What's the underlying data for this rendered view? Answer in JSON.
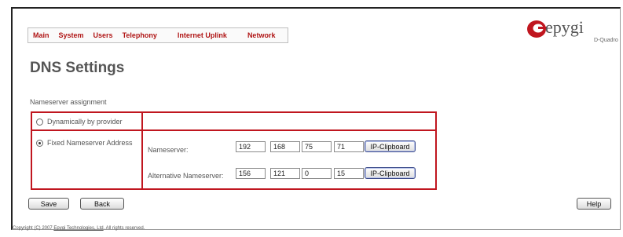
{
  "nav": {
    "items": [
      "Main",
      "System",
      "Users",
      "Telephony",
      "Internet Uplink",
      "Network"
    ]
  },
  "logo": {
    "word": "epygi",
    "sub": "D-Quadro"
  },
  "page_title": "DNS Settings",
  "section_label": "Nameserver assignment",
  "options": {
    "dynamic_label": "Dynamically by provider",
    "fixed_label": "Fixed Nameserver Address",
    "selected": "fixed"
  },
  "nameserver": {
    "label": "Nameserver:",
    "octets": [
      "192",
      "168",
      "75",
      "71"
    ],
    "clipboard_label": "IP-Clipboard"
  },
  "alt_nameserver": {
    "label": "Alternative Nameserver:",
    "octets": [
      "156",
      "121",
      "0",
      "15"
    ],
    "clipboard_label": "IP-Clipboard"
  },
  "buttons": {
    "save": "Save",
    "back": "Back",
    "help": "Help"
  },
  "footer": {
    "prefix": "Copyright (C) 2007",
    "company": "Epygi Technologies, Ltd",
    "suffix": ". All rights reserved."
  },
  "colors": {
    "accent": "#c0161f",
    "nav_text": "#b01515",
    "logo_red": "#c0161f"
  }
}
